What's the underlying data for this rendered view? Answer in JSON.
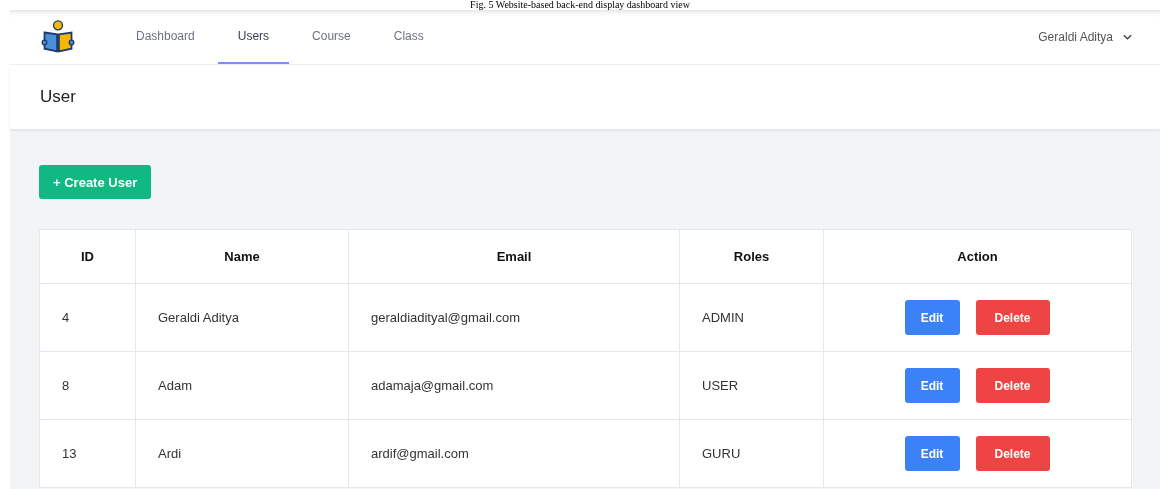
{
  "caption": "Fig. 5 Website-based back-end display dashboard view",
  "nav": {
    "items": [
      {
        "label": "Dashboard",
        "selected": false
      },
      {
        "label": "Users",
        "selected": true
      },
      {
        "label": "Course",
        "selected": false
      },
      {
        "label": "Class",
        "selected": false
      }
    ],
    "user": "Geraldi Aditya"
  },
  "page_title": "User",
  "create_button": "+ Create User",
  "table": {
    "columns": [
      "ID",
      "Name",
      "Email",
      "Roles",
      "Action"
    ],
    "rows": [
      {
        "id": "4",
        "name": "Geraldi Aditya",
        "email": "geraldiadityal@gmail.com",
        "role": "ADMIN",
        "actions": [
          "Edit",
          "Delete"
        ]
      },
      {
        "id": "8",
        "name": "Adam",
        "email": "adamaja@gmail.com",
        "role": "USER",
        "actions": [
          "Edit",
          "Delete"
        ]
      },
      {
        "id": "13",
        "name": "Ardi",
        "email": "ardif@gmail.com",
        "role": "GURU",
        "actions": [
          "Edit",
          "Delete"
        ]
      }
    ]
  }
}
